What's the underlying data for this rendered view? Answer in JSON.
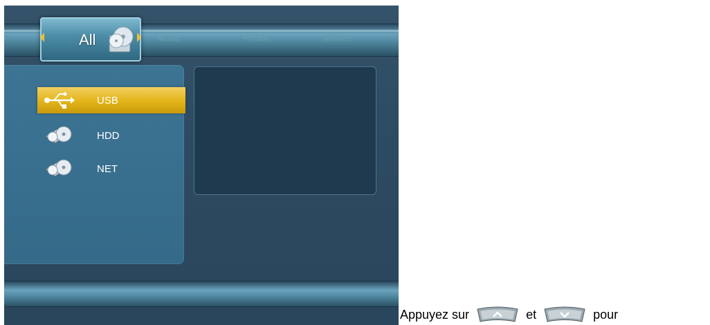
{
  "menu": {
    "tabs": [
      {
        "label": "All",
        "selected": true
      },
      {
        "label": "Music"
      },
      {
        "label": "Photos"
      },
      {
        "label": "Movies"
      }
    ]
  },
  "devices": [
    {
      "label": "USB",
      "icon": "usb-icon",
      "selected": true
    },
    {
      "label": "HDD",
      "icon": "disc-drive-icon"
    },
    {
      "label": "NET",
      "icon": "disc-drive-icon"
    }
  ],
  "caption": {
    "text_before": "Appuyez sur",
    "text_middle": "et",
    "text_after": "pour",
    "up_button_icon": "remote-up-button-icon",
    "down_button_icon": "remote-down-button-icon"
  },
  "colors": {
    "selection": "#e2b418",
    "panel": "#3d7494",
    "background": "#2c4a61"
  }
}
